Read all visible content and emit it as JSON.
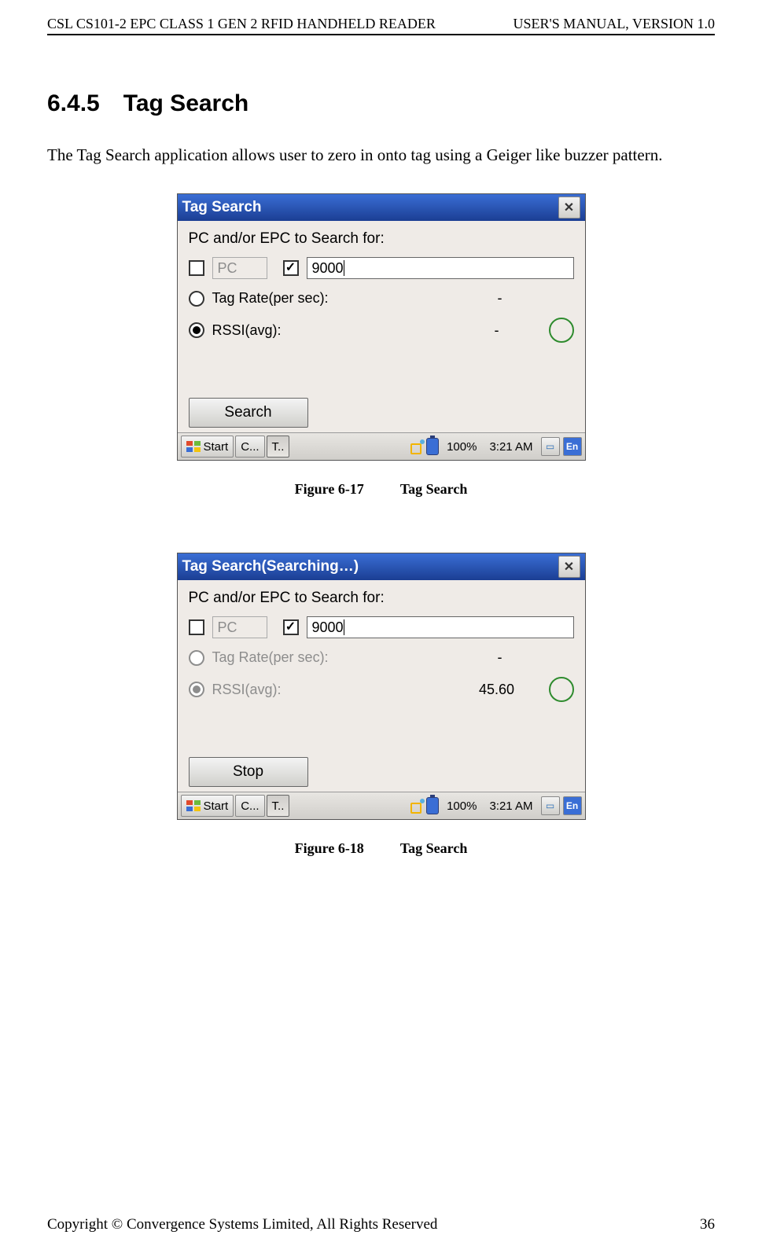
{
  "header": {
    "left": "CSL CS101-2 EPC CLASS 1 GEN 2 RFID HANDHELD READER",
    "right": "USER'S  MANUAL,  VERSION  1.0"
  },
  "section": {
    "number": "6.4.5",
    "title": "Tag Search"
  },
  "intro": "The Tag Search application allows user to zero in onto tag using a Geiger like buzzer pattern.",
  "fig1": {
    "title": "Tag Search",
    "prompt": "PC and/or EPC to Search for:",
    "pc_label": "PC",
    "epc_value": "9000",
    "rate_label": "Tag Rate(per sec):",
    "rate_value": "-",
    "rssi_label": "RSSI(avg):",
    "rssi_value": "-",
    "button": "Search",
    "taskbar": {
      "start": "Start",
      "b1": "C...",
      "b2": "T..",
      "batt": "100%",
      "time": "3:21 AM",
      "ime": "En"
    },
    "caption_num": "Figure 6-17",
    "caption_text": "Tag Search"
  },
  "fig2": {
    "title": "Tag Search(Searching…)",
    "prompt": "PC and/or EPC to Search for:",
    "pc_label": "PC",
    "epc_value": "9000",
    "rate_label": "Tag Rate(per sec):",
    "rate_value": "-",
    "rssi_label": "RSSI(avg):",
    "rssi_value": "45.60",
    "button": "Stop",
    "taskbar": {
      "start": "Start",
      "b1": "C...",
      "b2": "T..",
      "batt": "100%",
      "time": "3:21 AM",
      "ime": "En"
    },
    "caption_num": "Figure 6-18",
    "caption_text": "Tag Search"
  },
  "footer": {
    "left": "Copyright © Convergence Systems Limited, All Rights Reserved",
    "right": "36"
  }
}
